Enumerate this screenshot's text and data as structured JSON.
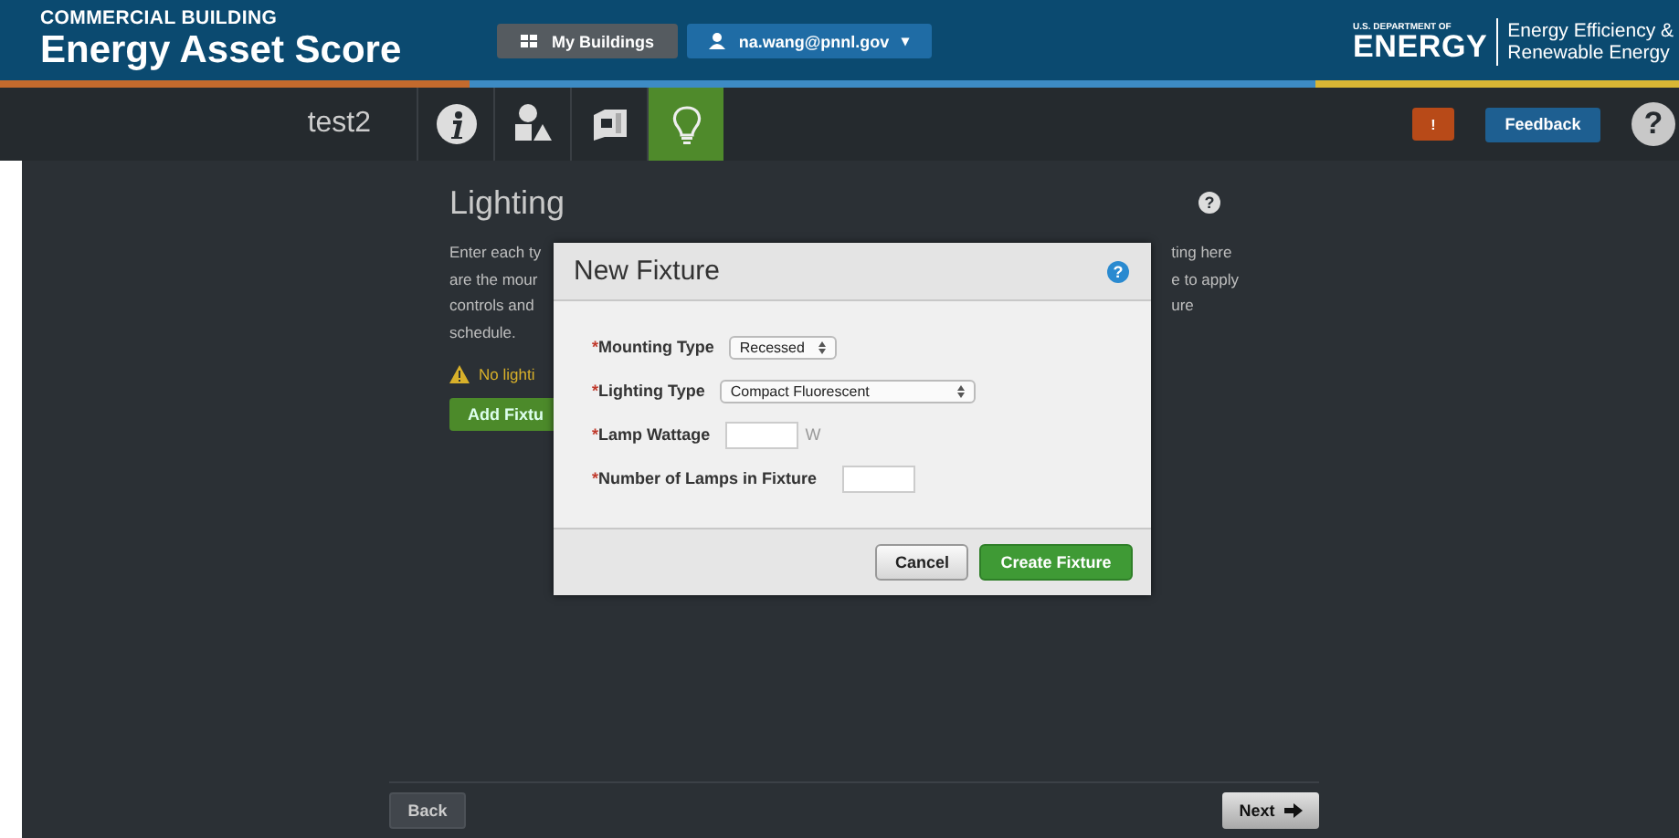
{
  "header": {
    "subtitle": "COMMERCIAL BUILDING",
    "title": "Energy Asset Score",
    "my_buildings": "My Buildings",
    "user": "na.wang@pnnl.gov",
    "user_caret": "▾",
    "doe_small": "U.S. DEPARTMENT OF",
    "doe_big": "ENERGY",
    "office_lines": [
      "Energy Efficiency &",
      "Renewable Energy"
    ]
  },
  "nav": {
    "building": "test2",
    "steps": [
      {
        "kind": "info",
        "selected": false
      },
      {
        "kind": "shapes",
        "selected": false
      },
      {
        "kind": "envelope",
        "selected": false
      },
      {
        "kind": "lighting",
        "selected": true
      }
    ],
    "alert": "!",
    "feedback": "Feedback",
    "help": "?"
  },
  "page": {
    "title": "Lighting",
    "intro_left": [
      "Enter each ty",
      "are the mour",
      "controls and",
      "schedule."
    ],
    "intro_right": [
      "ting here",
      "e to apply",
      "ure"
    ],
    "warning": "No lighti",
    "add_button": "Add Fixtu",
    "back": "Back",
    "next": "Next"
  },
  "dialog": {
    "title": "New Fixture",
    "fields": [
      {
        "kind": "select",
        "required_mark": "*",
        "label": "Mounting Type",
        "value": "Recessed"
      },
      {
        "kind": "select",
        "required_mark": "*",
        "label": "Lighting Type",
        "value": "Compact Fluorescent"
      },
      {
        "kind": "input",
        "required_mark": "*",
        "label": "Lamp Wattage",
        "unit": "W"
      },
      {
        "kind": "input",
        "required_mark": "*",
        "label": "Number of Lamps in Fixture"
      }
    ],
    "buttons": [
      {
        "kind": "secondary",
        "label": "Cancel"
      },
      {
        "kind": "primary",
        "label": "Create Fixture"
      }
    ]
  }
}
